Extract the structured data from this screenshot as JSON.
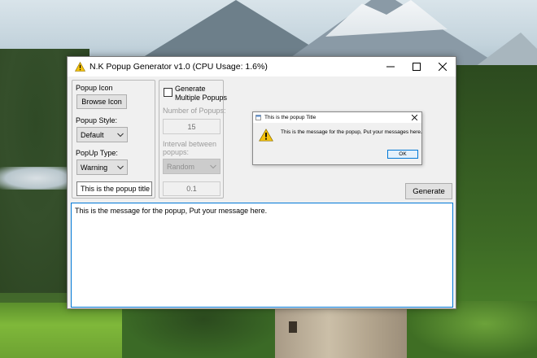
{
  "window": {
    "title": "N.K Popup Generator v1.0 (CPU Usage: 1.6%)"
  },
  "left_panel": {
    "popup_icon_label": "Popup Icon",
    "browse_icon_button": "Browse Icon",
    "popup_style_label": "Popup Style:",
    "popup_style_value": "Default",
    "popup_type_label": "PopUp Type:",
    "popup_type_value": "Warning",
    "popup_title_value": "This is the popup title"
  },
  "multi_panel": {
    "generate_multiple_label_line1": "Generate",
    "generate_multiple_label_line2": "Multiple Popups",
    "generate_multiple_checked": false,
    "number_of_popups_label": "Number of Popups:",
    "number_of_popups_value": "15",
    "interval_label_line1": "Interval between",
    "interval_label_line2": "popups:",
    "interval_mode_value": "Random",
    "interval_value": "0.1"
  },
  "generate_button": "Generate",
  "message_text": "This is the message for the popup, Put your message here.",
  "preview_popup": {
    "title": "This is the popup Title",
    "message": "This is the message for the popup, Put your messages here.",
    "ok_button": "OK",
    "icon": "warning-icon"
  },
  "colors": {
    "accent": "#0078d7",
    "warning": "#f4c20d",
    "window_bg": "#f0f0f0"
  }
}
